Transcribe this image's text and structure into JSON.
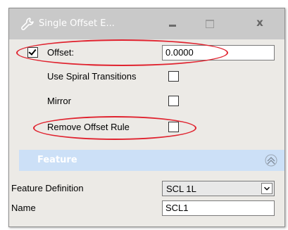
{
  "window": {
    "title": "Single Offset E...",
    "title_icon": "wrench-icon",
    "buttons": {
      "minimize": "minimize-icon",
      "maximize": "maximize-icon",
      "close_label": "x"
    }
  },
  "parameters": {
    "offset": {
      "label": "Offset:",
      "checked": true,
      "value": "0.0000"
    },
    "use_spiral": {
      "label": "Use Spiral Transitions",
      "checked": false
    },
    "mirror": {
      "label": "Mirror",
      "checked": false
    },
    "remove_offset_rule": {
      "label": "Remove Offset Rule",
      "checked": false
    }
  },
  "feature": {
    "header": "Feature",
    "collapse_icon": "chevron-up-icon",
    "definition_label": "Feature Definition",
    "definition_value": "SCL 1L",
    "name_label": "Name",
    "name_value": "SCL1"
  },
  "colors": {
    "highlight": "#e0232f",
    "section_header": "#cce0f7",
    "titlebar": "#c9c9c9"
  }
}
